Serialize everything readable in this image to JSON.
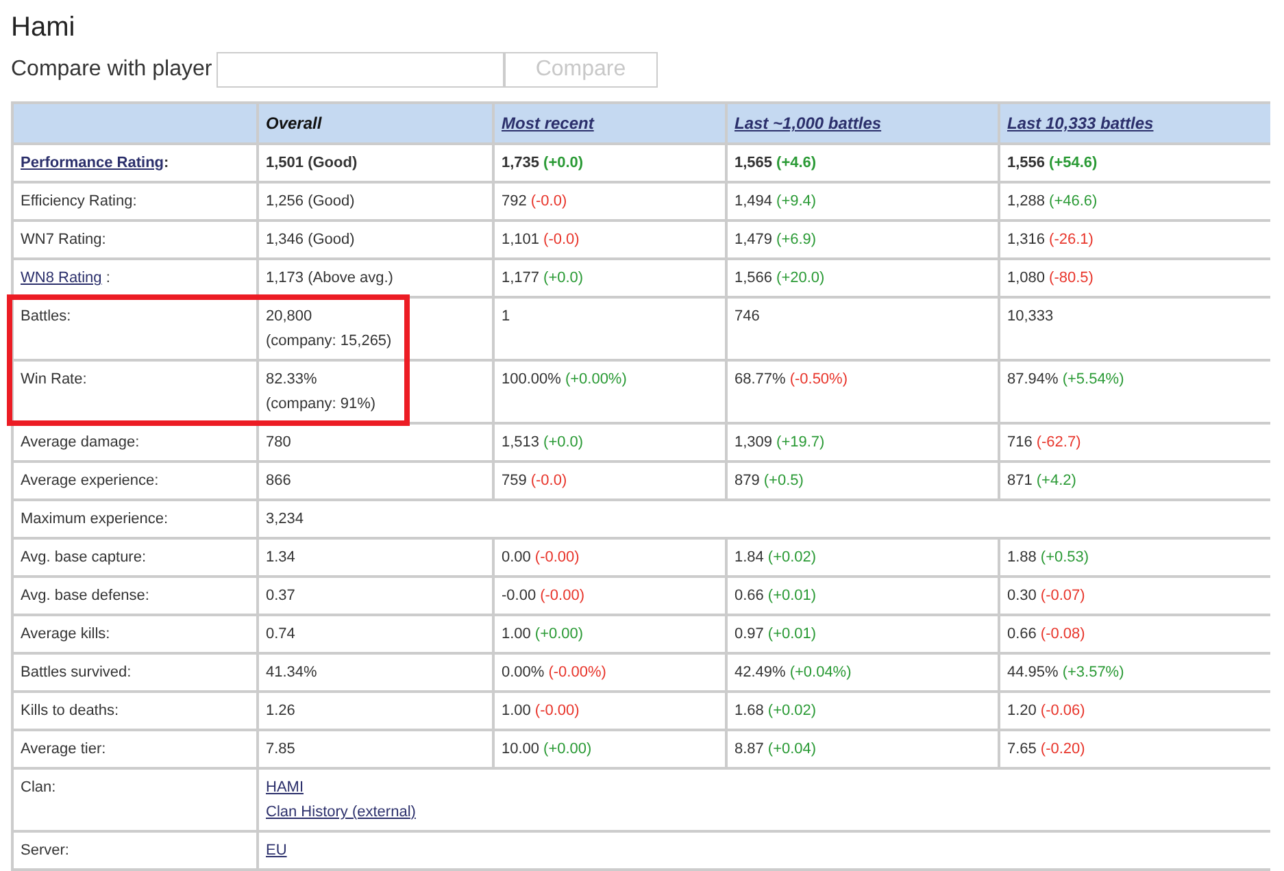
{
  "title": "Hami",
  "compare": {
    "label": "Compare with player",
    "button": "Compare",
    "button_disabled": true
  },
  "table": {
    "columns": [
      {
        "label": "Overall",
        "link": false
      },
      {
        "label": "Most recent",
        "link": true
      },
      {
        "label": "Last ~1,000 battles",
        "link": true
      },
      {
        "label": "Last 10,333 battles",
        "link": true
      }
    ],
    "rows": [
      {
        "kind": "stats",
        "label": "Performance Rating",
        "label_link": true,
        "suffix": ":",
        "bold": true,
        "cells": [
          {
            "value": "1,501 (Good)"
          },
          {
            "value": "1,735",
            "delta": "(+0.0)",
            "color": "#2a9a35"
          },
          {
            "value": "1,565",
            "delta": "(+4.6)",
            "color": "#2a9a35"
          },
          {
            "value": "1,556",
            "delta": "(+54.6)",
            "color": "#2a9a35"
          }
        ]
      },
      {
        "kind": "stats",
        "label": "Efficiency Rating:",
        "label_link": false,
        "bold": false,
        "cells": [
          {
            "value": "1,256 (Good)"
          },
          {
            "value": "792",
            "delta": "(-0.0)",
            "color": "#e8352b"
          },
          {
            "value": "1,494",
            "delta": "(+9.4)",
            "color": "#2a9a35"
          },
          {
            "value": "1,288",
            "delta": "(+46.6)",
            "color": "#2a9a35"
          }
        ]
      },
      {
        "kind": "stats",
        "label": "WN7 Rating:",
        "label_link": false,
        "bold": false,
        "cells": [
          {
            "value": "1,346 (Good)"
          },
          {
            "value": "1,101",
            "delta": "(-0.0)",
            "color": "#e8352b"
          },
          {
            "value": "1,479",
            "delta": "(+6.9)",
            "color": "#2a9a35"
          },
          {
            "value": "1,316",
            "delta": "(-26.1)",
            "color": "#e8352b"
          }
        ]
      },
      {
        "kind": "stats",
        "label": "WN8 Rating",
        "label_link": true,
        "suffix": " :",
        "bold": false,
        "cells": [
          {
            "value": "1,173 (Above avg.)"
          },
          {
            "value": "1,177",
            "delta": "(+0.0)",
            "color": "#2a9a35"
          },
          {
            "value": "1,566",
            "delta": "(+20.0)",
            "color": "#2a9a35"
          },
          {
            "value": "1,080",
            "delta": "(-80.5)",
            "color": "#e8352b"
          }
        ]
      },
      {
        "kind": "framed_group",
        "rows": [
          {
            "kind": "stats",
            "label": "Battles:",
            "label_link": false,
            "bold": false,
            "cells": [
              {
                "value": "20,800",
                "note": "(company: 15,265)"
              },
              {
                "value": "1"
              },
              {
                "value": "746"
              },
              {
                "value": "10,333"
              }
            ]
          },
          {
            "kind": "stats",
            "label": "Win Rate:",
            "label_link": false,
            "bold": false,
            "cells": [
              {
                "value": "82.33%",
                "note": "(company: 91%)"
              },
              {
                "value": "100.00%",
                "delta": "(+0.00%)",
                "color": "#2a9a35"
              },
              {
                "value": "68.77%",
                "delta": "(-0.50%)",
                "color": "#e8352b"
              },
              {
                "value": "87.94%",
                "delta": "(+5.54%)",
                "color": "#2a9a35"
              }
            ]
          }
        ]
      },
      {
        "kind": "stats",
        "label": "Average damage:",
        "label_link": false,
        "bold": false,
        "cells": [
          {
            "value": "780"
          },
          {
            "value": "1,513",
            "delta": "(+0.0)",
            "color": "#2a9a35"
          },
          {
            "value": "1,309",
            "delta": "(+19.7)",
            "color": "#2a9a35"
          },
          {
            "value": "716",
            "delta": "(-62.7)",
            "color": "#e8352b"
          }
        ]
      },
      {
        "kind": "stats",
        "label": "Average experience:",
        "label_link": false,
        "bold": false,
        "cells": [
          {
            "value": "866"
          },
          {
            "value": "759",
            "delta": "(-0.0)",
            "color": "#e8352b"
          },
          {
            "value": "879",
            "delta": "(+0.5)",
            "color": "#2a9a35"
          },
          {
            "value": "871",
            "delta": "(+4.2)",
            "color": "#2a9a35"
          }
        ]
      },
      {
        "kind": "span",
        "label": "Maximum experience:",
        "label_link": false,
        "bold": false,
        "value": "3,234"
      },
      {
        "kind": "stats",
        "label": "Avg. base capture:",
        "label_link": false,
        "bold": false,
        "cells": [
          {
            "value": "1.34"
          },
          {
            "value": "0.00",
            "delta": "(-0.00)",
            "color": "#e8352b"
          },
          {
            "value": "1.84",
            "delta": "(+0.02)",
            "color": "#2a9a35"
          },
          {
            "value": "1.88",
            "delta": "(+0.53)",
            "color": "#2a9a35"
          }
        ]
      },
      {
        "kind": "stats",
        "label": "Avg. base defense:",
        "label_link": false,
        "bold": false,
        "cells": [
          {
            "value": "0.37"
          },
          {
            "value": "-0.00",
            "delta": "(-0.00)",
            "color": "#e8352b"
          },
          {
            "value": "0.66",
            "delta": "(+0.01)",
            "color": "#2a9a35"
          },
          {
            "value": "0.30",
            "delta": "(-0.07)",
            "color": "#e8352b"
          }
        ]
      },
      {
        "kind": "stats",
        "label": "Average kills:",
        "label_link": false,
        "bold": false,
        "cells": [
          {
            "value": "0.74"
          },
          {
            "value": "1.00",
            "delta": "(+0.00)",
            "color": "#2a9a35"
          },
          {
            "value": "0.97",
            "delta": "(+0.01)",
            "color": "#2a9a35"
          },
          {
            "value": "0.66",
            "delta": "(-0.08)",
            "color": "#e8352b"
          }
        ]
      },
      {
        "kind": "stats",
        "label": "Battles survived:",
        "label_link": false,
        "bold": false,
        "cells": [
          {
            "value": "41.34%"
          },
          {
            "value": "0.00%",
            "delta": "(-0.00%)",
            "color": "#e8352b"
          },
          {
            "value": "42.49%",
            "delta": "(+0.04%)",
            "color": "#2a9a35"
          },
          {
            "value": "44.95%",
            "delta": "(+3.57%)",
            "color": "#2a9a35"
          }
        ]
      },
      {
        "kind": "stats",
        "label": "Kills to deaths:",
        "label_link": false,
        "bold": false,
        "cells": [
          {
            "value": "1.26"
          },
          {
            "value": "1.00",
            "delta": "(-0.00)",
            "color": "#e8352b"
          },
          {
            "value": "1.68",
            "delta": "(+0.02)",
            "color": "#2a9a35"
          },
          {
            "value": "1.20",
            "delta": "(-0.06)",
            "color": "#e8352b"
          }
        ]
      },
      {
        "kind": "stats",
        "label": "Average tier:",
        "label_link": false,
        "bold": false,
        "cells": [
          {
            "value": "7.85"
          },
          {
            "value": "10.00",
            "delta": "(+0.00)",
            "color": "#2a9a35"
          },
          {
            "value": "8.87",
            "delta": "(+0.04)",
            "color": "#2a9a35"
          },
          {
            "value": "7.65",
            "delta": "(-0.20)",
            "color": "#e8352b"
          }
        ]
      },
      {
        "kind": "links",
        "label": "Clan:",
        "label_link": false,
        "bold": false,
        "links": [
          "HAMI",
          "Clan History (external)"
        ]
      },
      {
        "kind": "links",
        "label": "Server:",
        "label_link": false,
        "bold": false,
        "links": [
          "EU"
        ]
      }
    ]
  }
}
